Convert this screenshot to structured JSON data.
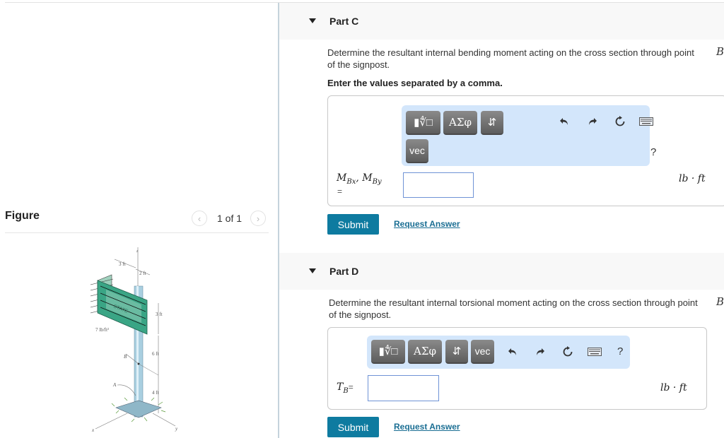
{
  "figure_panel": {
    "title": "Figure",
    "pager": {
      "current": 1,
      "total": 1,
      "text": "1 of 1",
      "prev_icon": "chevron-left-icon",
      "next_icon": "chevron-right-icon"
    },
    "image": {
      "description": "Signpost with sign under uniform wind pressure",
      "labels": {
        "dim_3ft_top": "3 ft",
        "dim_2ft": "2 ft",
        "dim_3ft_side": "3 ft",
        "dim_6ft": "6 ft",
        "dim_4ft": "4 ft",
        "pressure": "7 lb/ft²",
        "point_B": "B",
        "point_A": "A",
        "axis_z": "z",
        "axis_x": "x",
        "axis_y": "y",
        "sign_text": "STATE"
      }
    }
  },
  "parts": [
    {
      "title": "Part C",
      "question": "Determine the resultant internal bending moment acting on the cross section through point",
      "question_point": "B",
      "question_tail": "of the signpost.",
      "instruction": "Enter the values separated by a comma.",
      "toolbar": {
        "buttons": [
          {
            "name": "templates-button",
            "icon": "radical-template-icon",
            "label": "▮∜□"
          },
          {
            "name": "greek-symbols-button",
            "label": "ΑΣφ"
          },
          {
            "name": "arrows-button",
            "label": "⇵"
          },
          {
            "name": "vector-button",
            "label": "vec"
          }
        ],
        "icons": [
          "undo-icon",
          "redo-icon",
          "reset-icon",
          "keyboard-icon"
        ],
        "help_label": "?"
      },
      "variable": {
        "main1": "M",
        "sub1": "Bx",
        "sep": ",",
        "main2": "M",
        "sub2": "By",
        "equals": "="
      },
      "input_value": "",
      "unit": "lb · ft",
      "submit_label": "Submit",
      "request_label": "Request Answer"
    },
    {
      "title": "Part D",
      "question": "Determine the resultant internal torsional moment acting on the cross section through point",
      "question_point": "B",
      "question_tail": "of the signpost.",
      "toolbar": {
        "buttons": [
          {
            "name": "templates-button",
            "icon": "radical-template-icon",
            "label": "▮∜□"
          },
          {
            "name": "greek-symbols-button",
            "label": "ΑΣφ"
          },
          {
            "name": "arrows-button",
            "label": "⇵"
          },
          {
            "name": "vector-button",
            "label": "vec"
          }
        ],
        "icons": [
          "undo-icon",
          "redo-icon",
          "reset-icon",
          "keyboard-icon"
        ],
        "help_label": "?"
      },
      "variable": {
        "main": "T",
        "sub": "B",
        "equals": "="
      },
      "input_value": "",
      "unit": "lb · ft",
      "submit_label": "Submit",
      "request_label": "Request Answer"
    }
  ],
  "colors": {
    "submit_bg": "#0e7ba0",
    "link": "#1a6e93",
    "toolbar_bg": "#d3e6fb",
    "input_border": "#6f93d6",
    "header_bg": "#f8f8f8"
  }
}
